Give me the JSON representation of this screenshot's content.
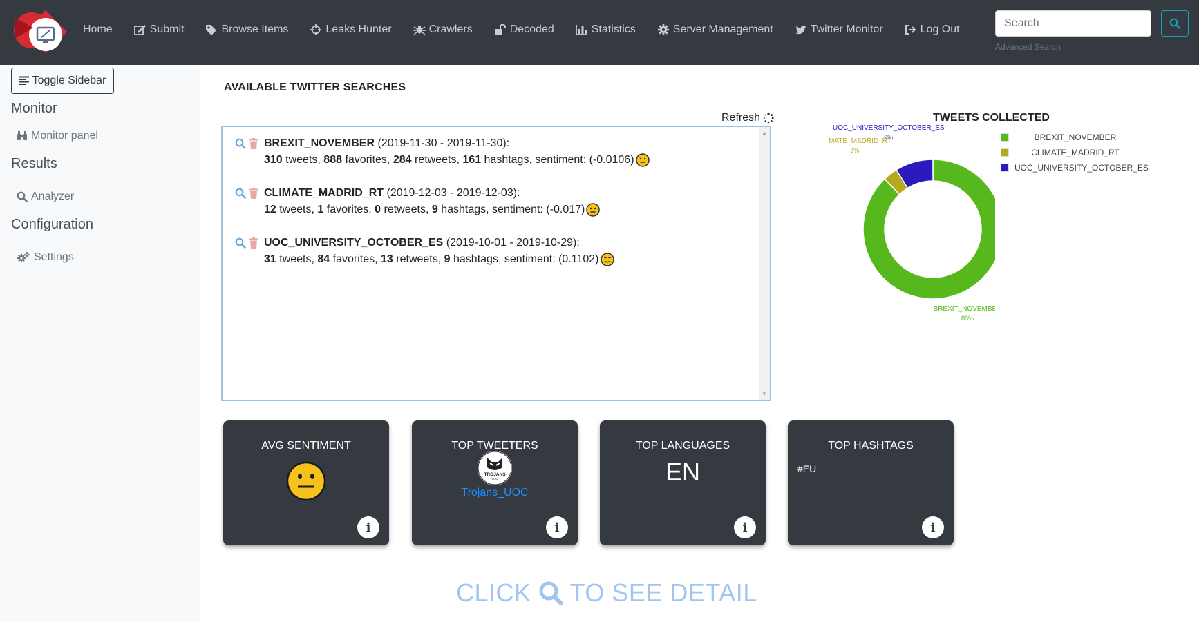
{
  "nav": {
    "items": [
      {
        "label": "Home",
        "icon": "none"
      },
      {
        "label": "Submit",
        "icon": "edit-icon"
      },
      {
        "label": "Browse Items",
        "icon": "tag-icon"
      },
      {
        "label": "Leaks Hunter",
        "icon": "crosshairs-icon"
      },
      {
        "label": "Crawlers",
        "icon": "spider-icon"
      },
      {
        "label": "Decoded",
        "icon": "unlock-icon"
      },
      {
        "label": "Statistics",
        "icon": "bar-chart-icon"
      },
      {
        "label": "Server Management",
        "icon": "gear-icon"
      },
      {
        "label": "Twitter Monitor",
        "icon": "twitter-icon"
      },
      {
        "label": "Log Out",
        "icon": "sign-out-icon"
      }
    ],
    "search_placeholder": "Search",
    "advanced_search": "Advanced Search"
  },
  "sidebar": {
    "toggle_label": "Toggle Sidebar",
    "sections": [
      {
        "heading": "Monitor",
        "link": "Monitor panel",
        "icon": "binoculars-icon"
      },
      {
        "heading": "Results",
        "link": "Analyzer",
        "icon": "search-icon"
      },
      {
        "heading": "Configuration",
        "link": "Settings",
        "icon": "cogs-icon"
      }
    ]
  },
  "main": {
    "title": "AVAILABLE TWITTER SEARCHES",
    "refresh_label": "Refresh",
    "searches": [
      {
        "name": "BREXIT_NOVEMBER",
        "dates": "(2019-11-30 - 2019-11-30):",
        "tweets": "310",
        "favorites": "888",
        "retweets": "284",
        "hashtags": "161",
        "sentiment": "(-0.0106)",
        "mood": "neutral"
      },
      {
        "name": "CLIMATE_MADRID_RT",
        "dates": "(2019-12-03 - 2019-12-03):",
        "tweets": "12",
        "favorites": "1",
        "retweets": "0",
        "hashtags": "9",
        "sentiment": "(-0.017)",
        "mood": "neutral"
      },
      {
        "name": "UOC_UNIVERSITY_OCTOBER_ES",
        "dates": "(2019-10-01 - 2019-10-29):",
        "tweets": "31",
        "favorites": "84",
        "retweets": "13",
        "hashtags": "9",
        "sentiment": "(0.1102)",
        "mood": "happy"
      }
    ],
    "words": {
      "tweets": "tweets,",
      "favorites": "favorites,",
      "retweets": "retweets,",
      "hashtags": "hashtags, sentiment:"
    }
  },
  "chart_data": {
    "type": "pie",
    "title": "TWEETS COLLECTED",
    "categories": [
      "BREXIT_NOVEMBER",
      "CLIMATE_MADRID_RT",
      "UOC_UNIVERSITY_OCTOBER_ES"
    ],
    "values": [
      310,
      12,
      31
    ],
    "percent_labels": [
      "88%",
      "3%",
      "9%"
    ],
    "colors": [
      "#56b81c",
      "#b5aa1b",
      "#2a1bbf"
    ],
    "legend": "right"
  },
  "cards": {
    "avg_sentiment": {
      "title": "AVG SENTIMENT",
      "mood": "neutral"
    },
    "top_tweeters": {
      "title": "TOP TWEETERS",
      "user": "Trojans_UOC",
      "avatar_text": "TROJANS",
      "avatar_sub": "UOC"
    },
    "top_languages": {
      "title": "TOP LANGUAGES",
      "value": "EN"
    },
    "top_hashtags": {
      "title": "TOP HASHTAGS",
      "value": "#EU"
    },
    "info_glyph": "i"
  },
  "cta": {
    "before": "CLICK",
    "after": "TO SEE DETAIL"
  }
}
